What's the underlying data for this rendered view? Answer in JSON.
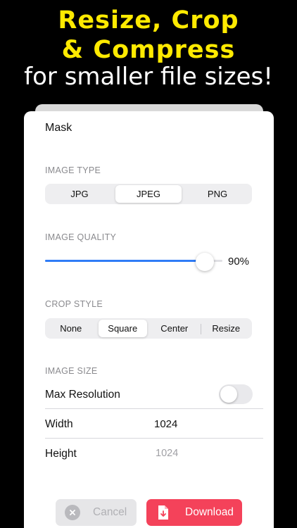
{
  "headline": {
    "line1": "Resize, Crop",
    "line2": "& Compress",
    "line3": "for smaller file sizes!"
  },
  "sheet": {
    "title": "Mask",
    "image_type": {
      "label": "IMAGE TYPE",
      "options": [
        "JPG",
        "JPEG",
        "PNG"
      ],
      "selected": "JPEG"
    },
    "image_quality": {
      "label": "IMAGE QUALITY",
      "value": 90,
      "value_text": "90%"
    },
    "crop_style": {
      "label": "CROP STYLE",
      "options": [
        "None",
        "Square",
        "Center",
        "Resize"
      ],
      "selected": "Square"
    },
    "image_size": {
      "label": "IMAGE SIZE",
      "max_resolution_label": "Max Resolution",
      "max_resolution_on": false,
      "width_label": "Width",
      "width_value": "1024",
      "height_label": "Height",
      "height_value": "1024"
    },
    "buttons": {
      "cancel_label": "Cancel",
      "download_label": "Download"
    }
  },
  "colors": {
    "headline_yellow": "#ffea00",
    "accent_blue": "#2f7cf6",
    "download_red": "#f4425a"
  },
  "icons": {
    "cancel": "close-circle-icon",
    "download": "file-download-icon"
  }
}
